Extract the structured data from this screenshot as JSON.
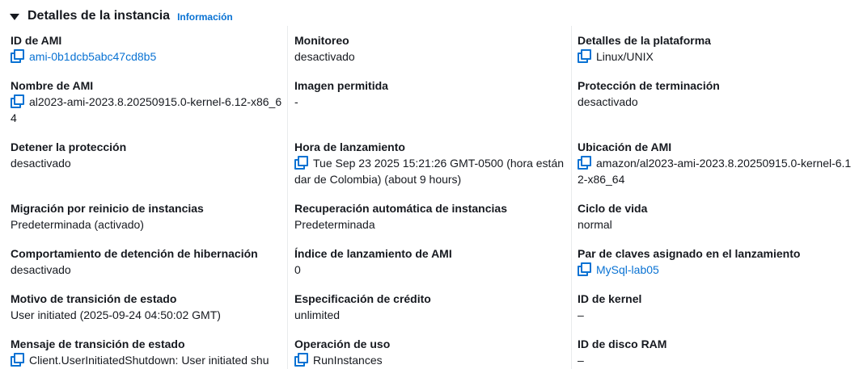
{
  "header": {
    "title": "Detalles de la instancia",
    "info_link": "Información"
  },
  "col1": [
    {
      "label": "ID de AMI",
      "value": "ami-0b1dcb5abc47cd8b5"
    },
    {
      "label": "Nombre de AMI",
      "value": "al2023-ami-2023.8.20250915.0-kernel-6.12-x86_64"
    },
    {
      "label": "Detener la protección",
      "value": "desactivado"
    },
    {
      "label": "Migración por reinicio de instancias",
      "value": "Predeterminada (activado)"
    },
    {
      "label": "Comportamiento de detención de hibernación",
      "value": "desactivado"
    },
    {
      "label": "Motivo de transición de estado",
      "value": "User initiated (2025-09-24 04:50:02 GMT)"
    },
    {
      "label": "Mensaje de transición de estado",
      "value": "Client.UserInitiatedShutdown: User initiated shu"
    }
  ],
  "col2": [
    {
      "label": "Monitoreo",
      "value": "desactivado"
    },
    {
      "label": "Imagen permitida",
      "value": "-"
    },
    {
      "label": "Hora de lanzamiento",
      "value": "Tue Sep 23 2025 15:21:26 GMT-0500 (hora estándar de Colombia) (about 9 hours)"
    },
    {
      "label": "Recuperación automática de instancias",
      "value": "Predeterminada"
    },
    {
      "label": "Índice de lanzamiento de AMI",
      "value": "0"
    },
    {
      "label": "Especificación de crédito",
      "value": "unlimited"
    },
    {
      "label": "Operación de uso",
      "value": "RunInstances"
    }
  ],
  "col3": [
    {
      "label": "Detalles de la plataforma",
      "value": "Linux/UNIX"
    },
    {
      "label": "Protección de terminación",
      "value": "desactivado"
    },
    {
      "label": "Ubicación de AMI",
      "value": "amazon/al2023-ami-2023.8.20250915.0-kernel-6.12-x86_64"
    },
    {
      "label": "Ciclo de vida",
      "value": "normal"
    },
    {
      "label": "Par de claves asignado en el lanzamiento",
      "value": "MySql-lab05"
    },
    {
      "label": "ID de kernel",
      "value": "–"
    },
    {
      "label": "ID de disco RAM",
      "value": "–"
    }
  ]
}
